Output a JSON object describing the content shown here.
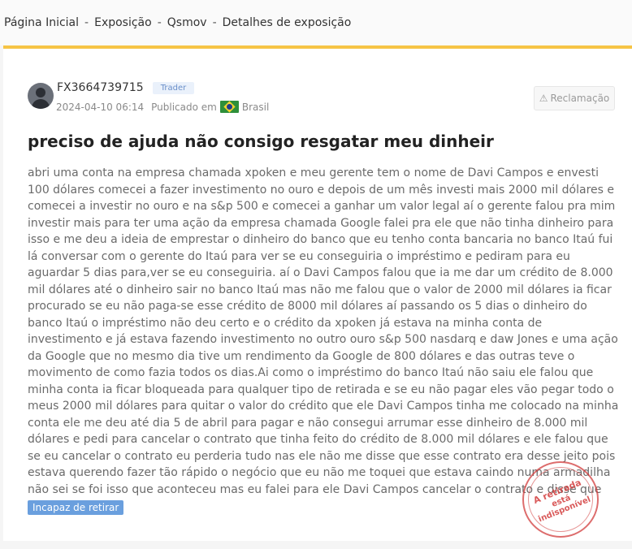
{
  "breadcrumb": {
    "items": [
      "Página Inicial",
      "Exposição",
      "Qsmov",
      "Detalhes de exposição"
    ],
    "separator": "-"
  },
  "post": {
    "username": "FX3664739715",
    "badge": "Trader",
    "datetime": "2024-04-10 06:14",
    "published_label": "Publicado em",
    "country": "Brasil",
    "country_flag_icon": "brazil-flag-icon",
    "complaint_label": "Reclamação",
    "title": "preciso de ajuda não consigo resgatar meu dinheir",
    "body": "abri uma conta na empresa chamada xpoken e meu gerente tem o nome de Davi Campos e envesti 100 dólares comecei a fazer investimento no ouro e depois de um mês investi mais 2000 mil dólares e comecei a investir no ouro e na s&p 500 e comecei a ganhar um valor legal aí o gerente falou pra mim investir mais para ter uma ação da empresa chamada Google falei pra ele que não tinha dinheiro para isso e me deu a ideia de emprestar o dinheiro do banco que eu tenho conta bancaria no banco Itaú fui lá conversar com o gerente do Itaú para ver se eu conseguiria o impréstimo e pediram para eu aguardar 5 dias para,ver se eu conseguiria. aí o Davi Campos falou que ia me dar um crédito de 8.000 mil dólares até o dinheiro sair no banco Itaú mas não me falou que o valor de 2000 mil dólares ia ficar procurado se eu não paga-se esse crédito de 8000 mil dólares aí passando os 5 dias o dinheiro do banco Itaú o impréstimo não deu certo e o crédito da xpoken já estava na minha conta de investimento e já estava fazendo investimento no outro ouro s&p 500 nasdarq e daw Jones e uma ação da Google que no mesmo dia tive um rendimento da Google de 800 dólares e das outras teve o movimento de como fazia todos os dias.Ai como o impréstimo do banco Itaú não saiu ele falou que minha conta ia ficar bloqueada para qualquer tipo de retirada e se eu não pagar eles vão pegar todo o meus 2000 mil dólares para quitar o valor do crédito que ele Davi Campos tinha me colocado na minha conta ele me deu até dia 5 de abril para pagar e não consegui arrumar esse dinheiro de 8.000 mil dólares e pedi para cancelar o contrato que tinha feito do crédito de 8.000 mil dólares e ele falou que se eu cancelar o contrato eu perderia tudo nas ele não me disse que esse contrato era desse jeito pois estava querendo fazer tão rápido o negócio que eu não me toquei que estava caindo numa armadilha não sei se foi isso que aconteceu mas eu falei para ele Davi Campos cancelar o contrato e disse que não daria a",
    "tag": "Incapaz de retirar",
    "stamp_line1": "A retirada",
    "stamp_line2": "está indisponível"
  },
  "colors": {
    "accent_bar": "#f6c445",
    "badge_text": "#6a8fc9",
    "tag_bg": "#6a9fde",
    "stamp": "#d23c3c"
  }
}
